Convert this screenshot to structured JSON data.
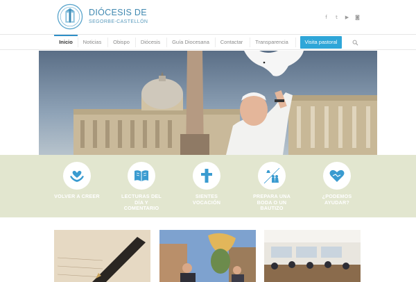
{
  "header": {
    "logo_line1": "DIÓCESIS DE",
    "logo_line2": "SEGORBE-CASTELLÓN",
    "social": [
      {
        "icon": "facebook-icon",
        "glyph": "f"
      },
      {
        "icon": "twitter-icon",
        "glyph": "t"
      },
      {
        "icon": "youtube-icon",
        "glyph": "▶"
      },
      {
        "icon": "instagram-icon",
        "glyph": "◙"
      }
    ]
  },
  "nav": {
    "items": [
      {
        "label": "Inicio"
      },
      {
        "label": "Noticias"
      },
      {
        "label": "Obispo"
      },
      {
        "label": "Diócesis"
      },
      {
        "label": "Guía Diocesana"
      },
      {
        "label": "Contactar"
      },
      {
        "label": "Transparencia"
      }
    ],
    "button_label": "Visita pastoral",
    "search_icon": "search-icon"
  },
  "features": [
    {
      "label": "VOLVER A CREER",
      "icon": "heart-hands-icon"
    },
    {
      "label": "LECTURAS DEL DÍA Y COMENTARIO",
      "icon": "book-icon"
    },
    {
      "label": "SIENTES VOCACIÓN",
      "icon": "cross-icon"
    },
    {
      "label": "PREPARA UNA BODA O UN BAUTIZO",
      "icon": "wedding-icon"
    },
    {
      "label": "¿PODEMOS AYUDAR?",
      "icon": "helping-heart-icon"
    }
  ],
  "colors": {
    "accent": "#2fa6d8",
    "band": "#e2e6cf",
    "icon_blue": "#3a9bd0"
  }
}
